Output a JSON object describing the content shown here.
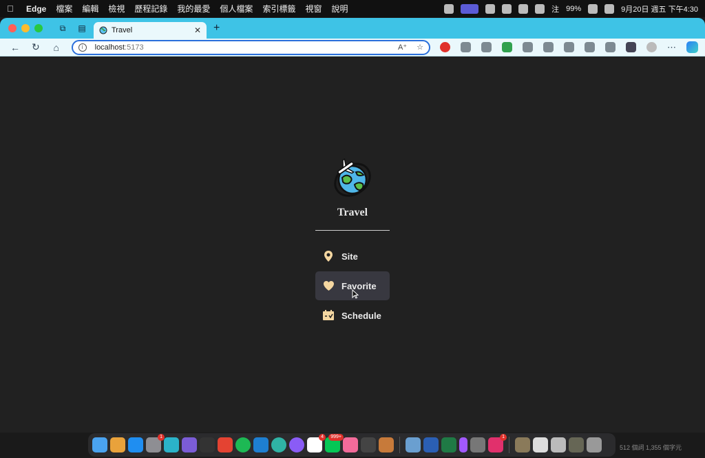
{
  "menubar": {
    "app": "Edge",
    "items": [
      "檔案",
      "編輯",
      "檢視",
      "歷程記錄",
      "我的最愛",
      "個人檔案",
      "索引標籤",
      "視窗",
      "說明"
    ],
    "battery": "99%",
    "input_method": "注",
    "datetime": "9月20日 週五 下午4:30"
  },
  "browser": {
    "tab_title": "Travel",
    "url_host": "localhost",
    "url_port": ":5173"
  },
  "page": {
    "app_title": "Travel",
    "nav": [
      {
        "label": "Site",
        "icon": "location-pin-icon"
      },
      {
        "label": "Favorite",
        "icon": "heart-icon",
        "active": true
      },
      {
        "label": "Schedule",
        "icon": "calendar-icon"
      }
    ],
    "accent_color": "#f5d7a1"
  },
  "dock": {
    "badges": {
      "settings": "1",
      "notion": "4",
      "line": "999+",
      "instagram": "1"
    }
  },
  "status_bar": {
    "text": "512 個詞   1,355 個字元"
  }
}
